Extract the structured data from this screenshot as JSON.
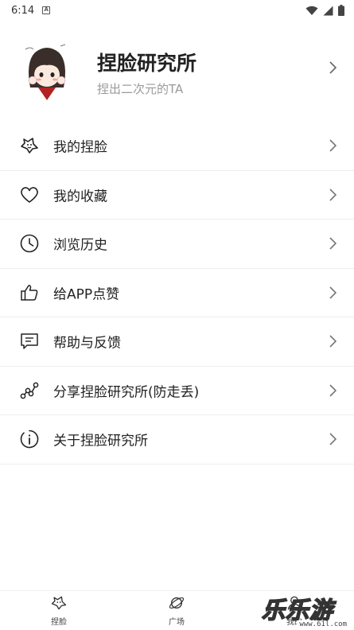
{
  "status_bar": {
    "time": "6:14",
    "notification_glyph": "A"
  },
  "profile": {
    "title": "捏脸研究所",
    "subtitle": "捏出二次元的TA"
  },
  "menu": [
    {
      "label": "我的捏脸",
      "icon": "face-pinch-icon"
    },
    {
      "label": "我的收藏",
      "icon": "heart-icon"
    },
    {
      "label": "浏览历史",
      "icon": "clock-icon"
    },
    {
      "label": "给APP点赞",
      "icon": "thumbs-up-icon"
    },
    {
      "label": "帮助与反馈",
      "icon": "feedback-message-icon"
    },
    {
      "label": "分享捏脸研究所(防走丢)",
      "icon": "share-icon"
    },
    {
      "label": "关于捏脸研究所",
      "icon": "info-icon"
    }
  ],
  "tabbar": {
    "tabs": [
      {
        "label": "捏脸"
      },
      {
        "label": "广场"
      },
      {
        "label": "我的"
      }
    ]
  },
  "watermark": {
    "text": "乐乐游戏",
    "url": "www.61l.com"
  }
}
